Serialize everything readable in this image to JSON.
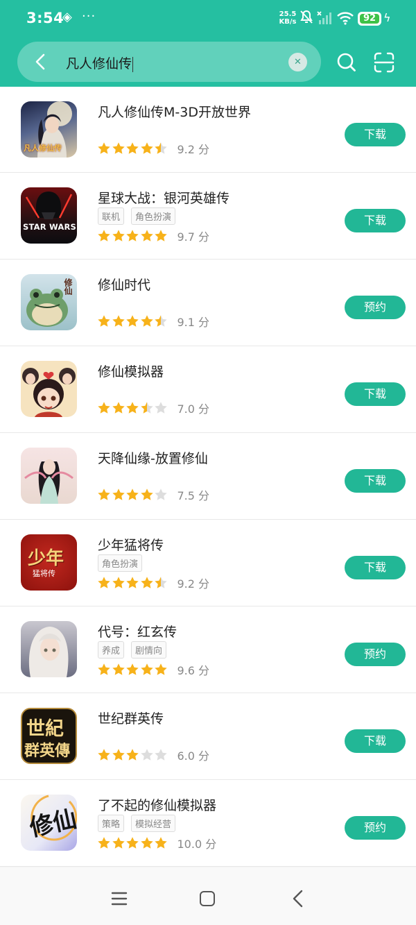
{
  "status_bar": {
    "time": "3:54",
    "net_speed_value": "25.5",
    "net_speed_unit": "KB/s",
    "battery": "92"
  },
  "search": {
    "query": "凡人修仙传"
  },
  "results": [
    {
      "name": "凡人修仙传M-3D开放世界",
      "tags": [],
      "rating": 4.5,
      "score": "9.2 分",
      "action": "下载",
      "icon": "fanren-icon"
    },
    {
      "name": "星球大战：银河英雄传",
      "tags": [
        "联机",
        "角色扮演"
      ],
      "rating": 5,
      "score": "9.7 分",
      "action": "下载",
      "icon": "starwars-icon"
    },
    {
      "name": "修仙时代",
      "tags": [],
      "rating": 4.5,
      "score": "9.1 分",
      "action": "预约",
      "icon": "frog-icon"
    },
    {
      "name": "修仙模拟器",
      "tags": [],
      "rating": 3.5,
      "score": "7.0 分",
      "action": "下载",
      "icon": "chibi-girl-icon"
    },
    {
      "name": "天降仙缘-放置修仙",
      "tags": [],
      "rating": 4,
      "score": "7.5 分",
      "action": "下载",
      "icon": "fairy-icon"
    },
    {
      "name": "少年猛将传",
      "tags": [
        "角色扮演"
      ],
      "rating": 4.5,
      "score": "9.2 分",
      "action": "下载",
      "icon": "shaonian-icon"
    },
    {
      "name": "代号：红玄传",
      "tags": [
        "养成",
        "剧情向"
      ],
      "rating": 5,
      "score": "9.6 分",
      "action": "预约",
      "icon": "white-hair-icon"
    },
    {
      "name": "世纪群英传",
      "tags": [],
      "rating": 3,
      "score": "6.0 分",
      "action": "下载",
      "icon": "shiji-icon"
    },
    {
      "name": "了不起的修仙模拟器",
      "tags": [
        "策略",
        "模拟经营"
      ],
      "rating": 5,
      "score": "10.0 分",
      "action": "预约",
      "icon": "xiuxian-calligraphy-icon"
    }
  ],
  "colors": {
    "brand": "#25bfa1",
    "button": "#22b796",
    "star": "#f7b21a",
    "star_empty": "#dddddd"
  },
  "logo_texts": {
    "fanren": "凡人修仙传",
    "starwars": "STAR WARS",
    "xiuxian_shidai": "修仙",
    "shaonian": "少年",
    "shaonian_sub": "猛将传",
    "shiji_1": "世紀",
    "shiji_2": "群英傳",
    "liaobuqi": "修仙"
  }
}
